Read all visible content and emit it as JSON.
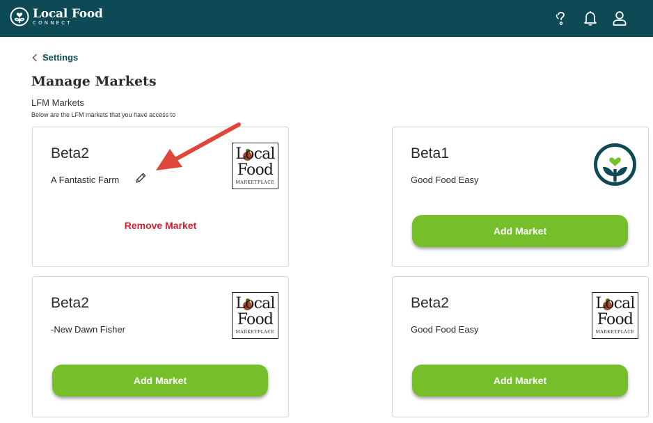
{
  "header": {
    "brand_name": "Local Food",
    "brand_sub": "CONNECT",
    "colors": {
      "bar": "#0d4a56",
      "icon": "#ffffff"
    },
    "icons": [
      "help-icon",
      "bell-icon",
      "user-icon"
    ]
  },
  "nav": {
    "back_label": "Settings"
  },
  "page": {
    "title": "Manage Markets",
    "section_title": "LFM Markets",
    "section_desc": "Below are the LFM markets that you have access to"
  },
  "lfm_logo": {
    "line1": "Local",
    "line2": "Food",
    "line3": "MARKETPLACE"
  },
  "cards": [
    {
      "title": "Beta2",
      "subtitle": "A Fantastic Farm",
      "logo": "local-food-marketplace-logo",
      "action": "Remove Market"
    },
    {
      "title": "Beta1",
      "subtitle": "Good Food Easy",
      "logo": "good-food-easy-logo",
      "action": "Add Market"
    },
    {
      "title": "Beta2",
      "subtitle": "-New Dawn Fisher",
      "logo": "local-food-marketplace-logo",
      "action": "Add Market"
    },
    {
      "title": "Beta2",
      "subtitle": "Good Food Easy",
      "logo": "local-food-marketplace-logo",
      "action": "Add Market"
    }
  ],
  "colors": {
    "accent_green": "#77bf2a",
    "danger_red": "#d62030",
    "annotation_arrow": "#e0453a"
  }
}
